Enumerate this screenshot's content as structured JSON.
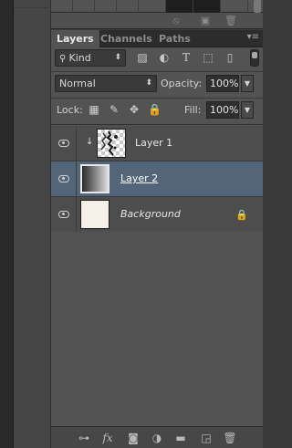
{
  "panel": {
    "tabs": [
      {
        "label": "Layers",
        "active": true
      },
      {
        "label": "Channels",
        "active": false
      },
      {
        "label": "Paths",
        "active": false
      }
    ],
    "menu_icon": "panel-menu-icon"
  },
  "filter": {
    "kind_label": "Kind",
    "icons": [
      "pixel-layer-filter-icon",
      "adjustment-filter-icon",
      "type-filter-icon",
      "shape-filter-icon",
      "smart-object-filter-icon"
    ]
  },
  "blend": {
    "mode": "Normal",
    "opacity_label": "Opacity:",
    "opacity_value": "100%",
    "lock_label": "Lock:",
    "fill_label": "Fill:",
    "fill_value": "100%"
  },
  "layers": [
    {
      "name": "Layer 1",
      "visible": true,
      "selected": false,
      "clipped": true,
      "thumbnail": "sketch"
    },
    {
      "name": "Layer 2",
      "visible": true,
      "selected": true,
      "clipped": false,
      "thumbnail": "gradient"
    },
    {
      "name": "Background",
      "visible": true,
      "selected": false,
      "locked": true,
      "thumbnail": "paper"
    }
  ],
  "bottom_icons": [
    "link-layers-icon",
    "fx-icon",
    "layer-mask-icon",
    "adjustment-layer-icon",
    "group-folder-icon",
    "new-layer-icon",
    "trash-icon"
  ],
  "colors": {
    "panel_bg": "#535353",
    "selection": "#536579",
    "tab_bar": "#2c2c2c"
  }
}
